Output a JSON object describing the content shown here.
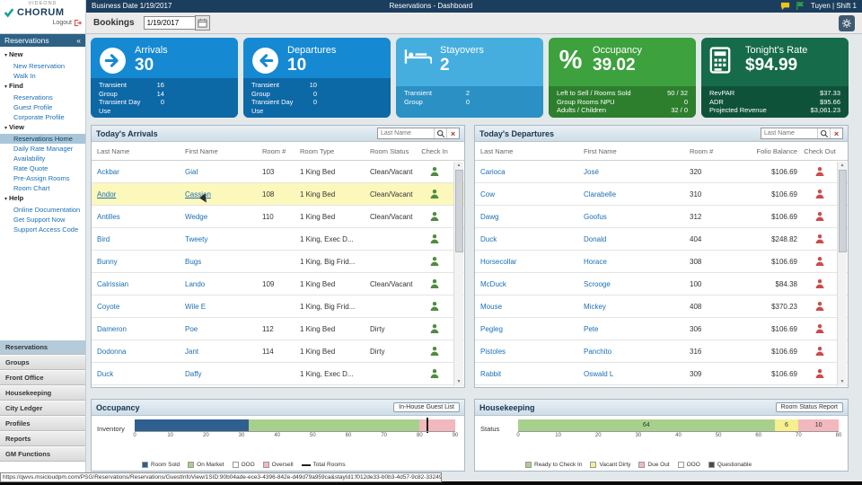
{
  "colors": {
    "topbar_navy": "#1c3e5e",
    "card_blue": "#1689d3",
    "card_light_blue": "#45aede",
    "card_green": "#3da13d",
    "card_dark_green": "#166b4a",
    "link_blue": "#1a6fb5",
    "highlight_row": "#fcf8bc"
  },
  "topbar": {
    "brand_small": "VIDEOND",
    "brand": "CHORUM",
    "logout_label": "Logout",
    "business_date": "Business Date 1/19/2017",
    "page_title": "Reservations - Dashboard",
    "user_info": "Tuyen | Shift 1"
  },
  "bookings_bar": {
    "label": "Bookings",
    "date_value": "1/19/2017"
  },
  "sidebar": {
    "header": "Reservations",
    "collapse_glyph": "«",
    "tree": [
      {
        "kind": "sec",
        "label": "New"
      },
      {
        "kind": "link",
        "label": "New Reservation"
      },
      {
        "kind": "link",
        "label": "Walk In"
      },
      {
        "kind": "sec",
        "label": "Find"
      },
      {
        "kind": "link",
        "label": "Reservations"
      },
      {
        "kind": "link",
        "label": "Guest Profile"
      },
      {
        "kind": "link",
        "label": "Corporate Profile"
      },
      {
        "kind": "sec",
        "label": "View"
      },
      {
        "kind": "active",
        "label": "Reservations Home"
      },
      {
        "kind": "link",
        "label": "Daily Rate Manager"
      },
      {
        "kind": "link",
        "label": "Availability"
      },
      {
        "kind": "link",
        "label": "Rate Quote"
      },
      {
        "kind": "link",
        "label": "Pre-Assign Rooms"
      },
      {
        "kind": "link",
        "label": "Room Chart"
      },
      {
        "kind": "sec",
        "label": "Help"
      },
      {
        "kind": "link",
        "label": "Online Documentation"
      },
      {
        "kind": "link",
        "label": "Get Support Now"
      },
      {
        "kind": "link",
        "label": "Support Access Code"
      }
    ],
    "modules": [
      {
        "label": "Reservations",
        "state": "active"
      },
      {
        "label": "Groups",
        "state": ""
      },
      {
        "label": "Front Office",
        "state": ""
      },
      {
        "label": "Housekeeping",
        "state": ""
      },
      {
        "label": "City Ledger",
        "state": ""
      },
      {
        "label": "Profiles",
        "state": ""
      },
      {
        "label": "Reports",
        "state": ""
      },
      {
        "label": "GM Functions",
        "state": ""
      }
    ]
  },
  "kpi_cards": [
    {
      "title": "Arrivals",
      "value": "30",
      "rows": [
        {
          "label": "Transient",
          "value": "16"
        },
        {
          "label": "Group",
          "value": "14"
        },
        {
          "label": "Transient Day Use",
          "value": "0"
        }
      ]
    },
    {
      "title": "Departures",
      "value": "10",
      "rows": [
        {
          "label": "Transient",
          "value": "10"
        },
        {
          "label": "Group",
          "value": "0"
        },
        {
          "label": "Transient Day Use",
          "value": "0"
        }
      ]
    },
    {
      "title": "Stayovers",
      "value": "2",
      "rows": [
        {
          "label": "Transient",
          "value": "2"
        },
        {
          "label": "Group",
          "value": "0"
        }
      ]
    },
    {
      "title": "Occupancy",
      "value": "39.02",
      "rows": [
        {
          "label": "Left to Sell / Rooms Sold",
          "value": "50 / 32"
        },
        {
          "label": "Group Rooms NPU",
          "value": "0"
        },
        {
          "label": "Adults / Children",
          "value": "32 / 0"
        }
      ]
    },
    {
      "title": "Tonight's Rate",
      "value": "$94.99",
      "rows": [
        {
          "label": "RevPAR",
          "value": "$37.33"
        },
        {
          "label": "ADR",
          "value": "$95.66"
        },
        {
          "label": "Projected Revenue",
          "value": "$3,061.23"
        }
      ]
    }
  ],
  "arrivals_panel": {
    "title": "Today's Arrivals",
    "search_placeholder": "Last Name",
    "columns": [
      "Last Name",
      "First Name",
      "Room #",
      "Room Type",
      "Room Status",
      "Check In"
    ],
    "rows": [
      {
        "last": "Ackbar",
        "first": "Gial",
        "room": "103",
        "type": "1 King Bed",
        "status": "Clean/Vacant",
        "state": ""
      },
      {
        "last": "Andor",
        "first": "Cassian",
        "room": "108",
        "type": "1 King Bed",
        "status": "Clean/Vacant",
        "state": "highlight"
      },
      {
        "last": "Antilles",
        "first": "Wedge",
        "room": "110",
        "type": "1 King Bed",
        "status": "Clean/Vacant",
        "state": ""
      },
      {
        "last": "Bird",
        "first": "Tweety",
        "room": "",
        "type": "1 King, Exec D...",
        "status": "",
        "state": ""
      },
      {
        "last": "Bunny",
        "first": "Bugs",
        "room": "",
        "type": "1 King, Big Frid...",
        "status": "",
        "state": ""
      },
      {
        "last": "Calrissian",
        "first": "Lando",
        "room": "109",
        "type": "1 King Bed",
        "status": "Clean/Vacant",
        "state": ""
      },
      {
        "last": "Coyote",
        "first": "Wile E",
        "room": "",
        "type": "1 King, Big Frid...",
        "status": "",
        "state": ""
      },
      {
        "last": "Dameron",
        "first": "Poe",
        "room": "112",
        "type": "1 King Bed",
        "status": "Dirty",
        "state": ""
      },
      {
        "last": "Dodonna",
        "first": "Jant",
        "room": "114",
        "type": "1 King Bed",
        "status": "Dirty",
        "state": ""
      },
      {
        "last": "Duck",
        "first": "Daffy",
        "room": "",
        "type": "1 King, Exec D...",
        "status": "",
        "state": ""
      }
    ]
  },
  "departures_panel": {
    "title": "Today's Departures",
    "search_placeholder": "Last Name",
    "columns": [
      "Last Name",
      "First Name",
      "Room #",
      "Folio Balance",
      "Check Out"
    ],
    "rows": [
      {
        "last": "Carioca",
        "first": "José",
        "room": "320",
        "folio": "$106.69",
        "state": ""
      },
      {
        "last": "Cow",
        "first": "Clarabelle",
        "room": "310",
        "folio": "$106.69",
        "state": ""
      },
      {
        "last": "Dawg",
        "first": "Goofus",
        "room": "312",
        "folio": "$106.69",
        "state": ""
      },
      {
        "last": "Duck",
        "first": "Donald",
        "room": "404",
        "folio": "$248.82",
        "state": ""
      },
      {
        "last": "Horsecollar",
        "first": "Horace",
        "room": "308",
        "folio": "$106.69",
        "state": ""
      },
      {
        "last": "McDuck",
        "first": "Scrooge",
        "room": "100",
        "folio": "$84.38",
        "state": ""
      },
      {
        "last": "Mouse",
        "first": "Mickey",
        "room": "408",
        "folio": "$370.23",
        "state": ""
      },
      {
        "last": "Pegleg",
        "first": "Pete",
        "room": "306",
        "folio": "$106.69",
        "state": ""
      },
      {
        "last": "Pistoles",
        "first": "Panchito",
        "room": "316",
        "folio": "$106.69",
        "state": ""
      },
      {
        "last": "Rabbit",
        "first": "Oswald L",
        "room": "309",
        "folio": "$106.69",
        "state": ""
      }
    ]
  },
  "occupancy_panel": {
    "title": "Occupancy",
    "button": "In-House Guest List",
    "row_label": "Inventory",
    "chart": {
      "type": "bar",
      "axis_max": 90,
      "tick_step": 10,
      "marker_value": 82,
      "segments": [
        {
          "name": "Room Sold",
          "value": 32,
          "color": "#2f5f8f",
          "label": ""
        },
        {
          "name": "On Market",
          "value": 48,
          "color": "#a8d08d",
          "label": ""
        },
        {
          "name": "Oversell",
          "value": 10,
          "color": "#f2b8bd",
          "label": ""
        }
      ]
    },
    "legend": [
      {
        "label": "Room Sold",
        "color": "#2f5f8f"
      },
      {
        "label": "On Market",
        "color": "#a8d08d"
      },
      {
        "label": "OOO",
        "color": "#ffffff"
      },
      {
        "label": "Oversell",
        "color": "#f2b8bd"
      },
      {
        "label": "Total Rooms",
        "line": true
      }
    ]
  },
  "housekeeping_panel": {
    "title": "Housekeeping",
    "button": "Room Status Report",
    "row_label": "Status",
    "chart": {
      "type": "bar",
      "axis_max": 80,
      "tick_step": 10,
      "segments": [
        {
          "name": "Ready to Check In",
          "value": 64,
          "color": "#a8d08d",
          "label": "64"
        },
        {
          "name": "Vacant Dirty",
          "value": 6,
          "color": "#f5ef8e",
          "label": "6"
        },
        {
          "name": "Due Out",
          "value": 10,
          "color": "#f2b8bd",
          "label": "10"
        }
      ]
    },
    "legend": [
      {
        "label": "Ready to Check In",
        "color": "#a8d08d"
      },
      {
        "label": "Vacant Dirty",
        "color": "#f5ef8e"
      },
      {
        "label": "Due Out",
        "color": "#f2b8bd"
      },
      {
        "label": "OOO",
        "color": "#ffffff"
      },
      {
        "label": "Questionable",
        "color": "#4a4a4a"
      }
    ]
  },
  "status_bar": {
    "url": "https://qwvs.msicloudpm.com/PSG/Reservations/Reservations/GuestInfoView/1SID:90b04ade-ece3-4396-842e-d49d79a959ca&stayId1:f012de33-b0b3-4d57-9c82-33249c3d3768..."
  }
}
